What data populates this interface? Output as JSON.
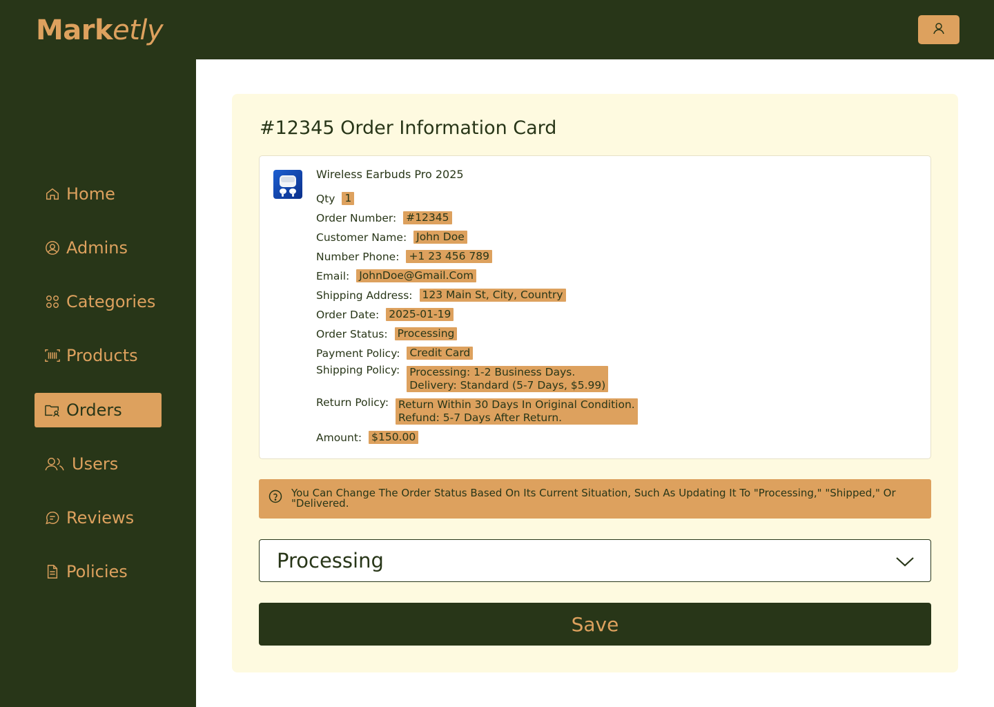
{
  "app": {
    "logo_main": "Mark",
    "logo_accent": "etly"
  },
  "header": {
    "profile_icon": "user-icon"
  },
  "sidebar": {
    "items": [
      {
        "label": "Home",
        "icon": "home-icon"
      },
      {
        "label": "Admins",
        "icon": "admin-icon"
      },
      {
        "label": "Categories",
        "icon": "categories-icon"
      },
      {
        "label": "Products",
        "icon": "barcode-icon"
      },
      {
        "label": "Orders",
        "icon": "folder-user-icon",
        "active": true
      },
      {
        "label": "Users",
        "icon": "users-icon"
      },
      {
        "label": "Reviews",
        "icon": "chat-icon"
      },
      {
        "label": "Policies",
        "icon": "document-icon"
      }
    ]
  },
  "card": {
    "title": "#12345 Order Information Card",
    "product_name": "Wireless Earbuds Pro 2025",
    "fields": [
      {
        "label": "Qty",
        "value": "1"
      },
      {
        "label": "Order Number:",
        "value": "#12345"
      },
      {
        "label": "Customer Name:",
        "value": "John Doe"
      },
      {
        "label": "Number Phone:",
        "value": "+1 23 456 789"
      },
      {
        "label": "Email:",
        "value": "JohnDoe@Gmail.Com"
      },
      {
        "label": "Shipping Address:",
        "value": "123 Main St, City, Country"
      },
      {
        "label": "Order Date:",
        "value": "2025-01-19"
      },
      {
        "label": "Order Status:",
        "value": "Processing"
      },
      {
        "label": "Payment Policy:",
        "value": "Credit Card"
      },
      {
        "label": "Shipping Policy:",
        "value": "Processing: 1-2 Business Days.\nDelivery: Standard (5-7 Days, $5.99)"
      },
      {
        "label": "Return Policy:",
        "value": "Return Within 30 Days In Original Condition.\nRefund: 5-7 Days After Return."
      },
      {
        "label": "Amount:",
        "value": "$150.00"
      }
    ],
    "hint": "You Can Change The Order Status Based On Its Current Situation, Such As Updating It To \"Processing,\" \"Shipped,\" Or \"Delivered.",
    "status_select": {
      "selected": "Processing"
    },
    "save_label": "Save"
  },
  "colors": {
    "primary": "#283618",
    "accent": "#DDA15E",
    "card_bg": "#FEFAE0"
  }
}
